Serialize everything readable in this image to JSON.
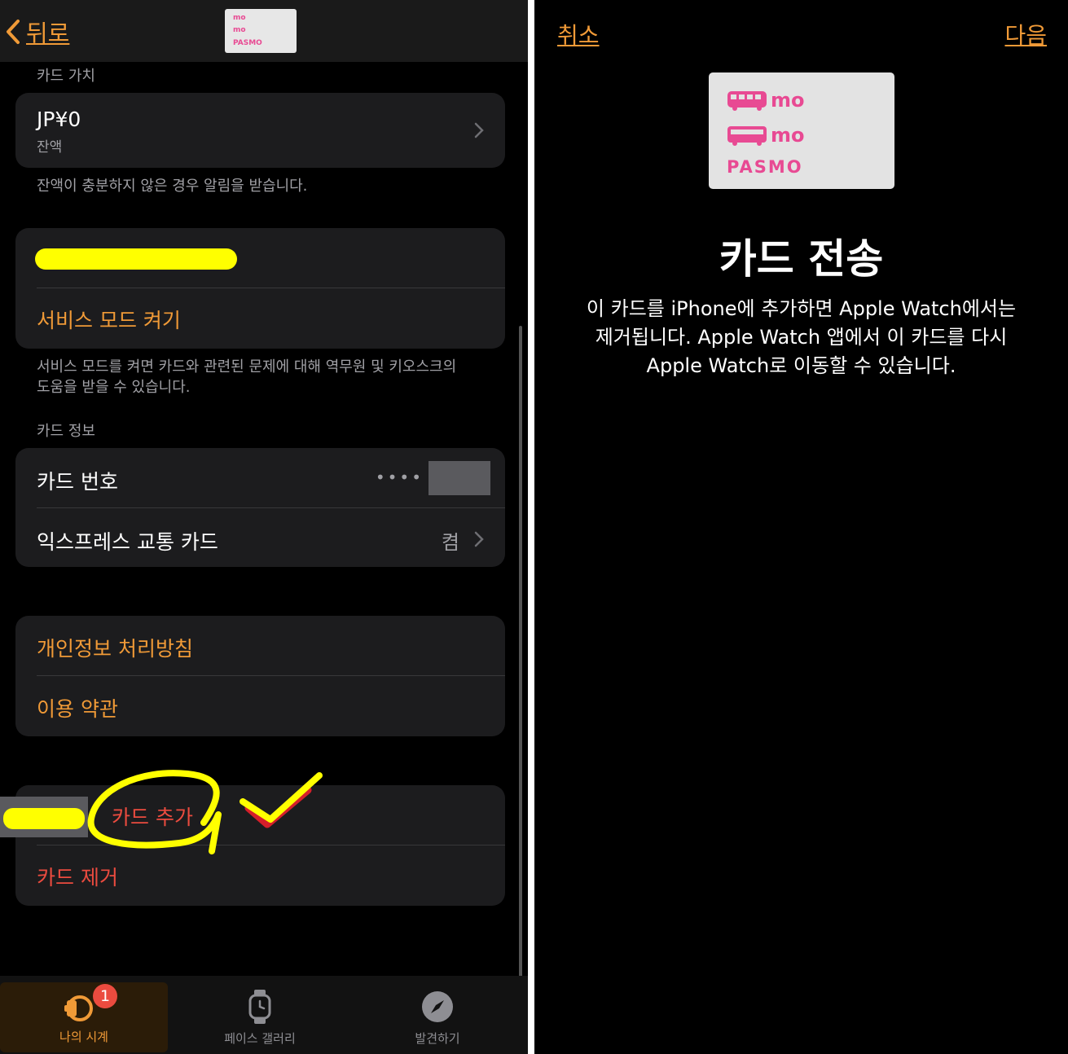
{
  "left": {
    "nav": {
      "back_label": "뒤로"
    },
    "card_thumb": {
      "rows": [
        "mo",
        "mo",
        "PASMO"
      ]
    },
    "card_value": {
      "section": "카드 가치",
      "balance": "JP¥0",
      "balance_sub": "잔액",
      "footnote": "잔액이 충분하지 않은 경우 알림을 받습니다."
    },
    "service": {
      "toggle_label": "서비스 모드 켜기",
      "footnote_1": "서비스 모드를 켜면 카드와 관련된 문제에 대해 역무원 및 키오스크의",
      "footnote_2": "도움을 받을 수 있습니다."
    },
    "card_info": {
      "section": "카드 정보",
      "number_label": "카드 번호",
      "number_dots": "••••",
      "express_label": "익스프레스 교통 카드",
      "express_value": "켬"
    },
    "legal": {
      "privacy": "개인정보 처리방침",
      "terms": "이용 약관"
    },
    "actions": {
      "add": "카드 추가",
      "remove": "카드 제거"
    },
    "tabbar": {
      "tabs": [
        {
          "label": "나의 시계",
          "badge": "1",
          "icon": "watch-icon"
        },
        {
          "label": "페이스 갤러리",
          "icon": "watch-face-icon"
        },
        {
          "label": "발견하기",
          "icon": "compass-icon"
        }
      ]
    }
  },
  "right": {
    "cancel": "취소",
    "next": "다음",
    "card": {
      "rows": [
        "mo",
        "mo",
        "PASMO"
      ]
    },
    "title": "카드 전송",
    "body_1": "이 카드를 iPhone에 추가하면 Apple Watch에서는",
    "body_2": "제거됩니다. Apple Watch 앱에서 이 카드를 다시",
    "body_3": "Apple Watch로 이동할 수 있습니다."
  },
  "colors": {
    "accent": "#f09a37",
    "destructive": "#eb4b3f",
    "highlight": "#ffff00",
    "pasmo_pink": "#e84a93"
  }
}
